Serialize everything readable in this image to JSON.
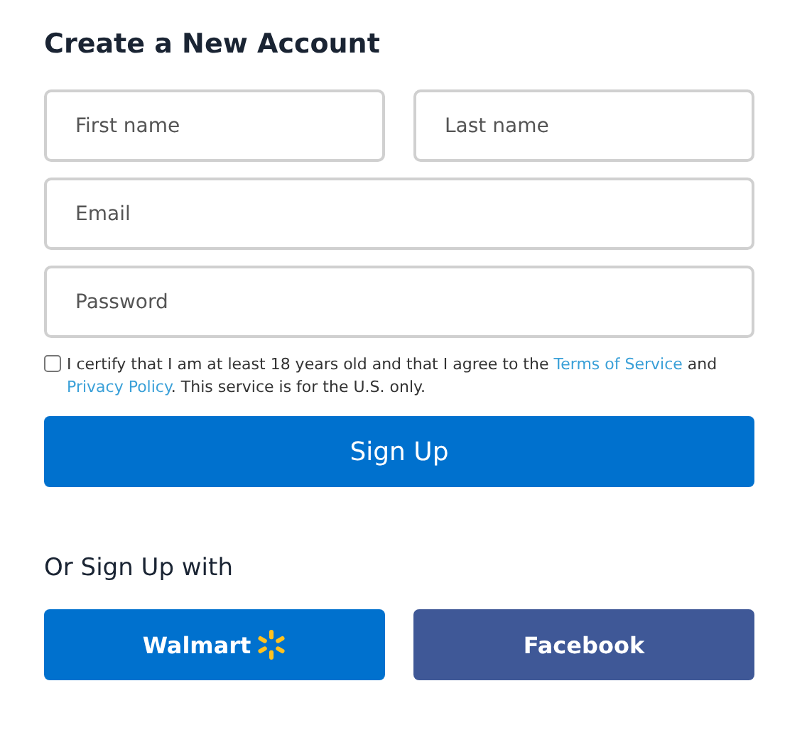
{
  "title": "Create a New Account",
  "fields": [
    [
      {
        "placeholder": "First name"
      },
      {
        "placeholder": "Last name"
      }
    ],
    [
      {
        "placeholder": "Email"
      }
    ],
    [
      {
        "placeholder": "Password"
      }
    ]
  ],
  "consent": {
    "checked": false,
    "parts": [
      {
        "kind": "text",
        "text": "I certify that I am at least 18 years old and that I agree to the "
      },
      {
        "kind": "link",
        "text": "Terms of Service"
      },
      {
        "kind": "text",
        "text": " and "
      },
      {
        "kind": "link",
        "text": "Privacy Policy"
      },
      {
        "kind": "text",
        "text": ". This service is for the U.S. only."
      }
    ]
  },
  "submit": "Sign Up",
  "alt_heading": "Or Sign Up with",
  "social": [
    {
      "kind": "walmart",
      "label": "Walmart",
      "color": "#0071ce"
    },
    {
      "kind": "facebook",
      "label": "Facebook",
      "color": "#3f5897"
    }
  ]
}
